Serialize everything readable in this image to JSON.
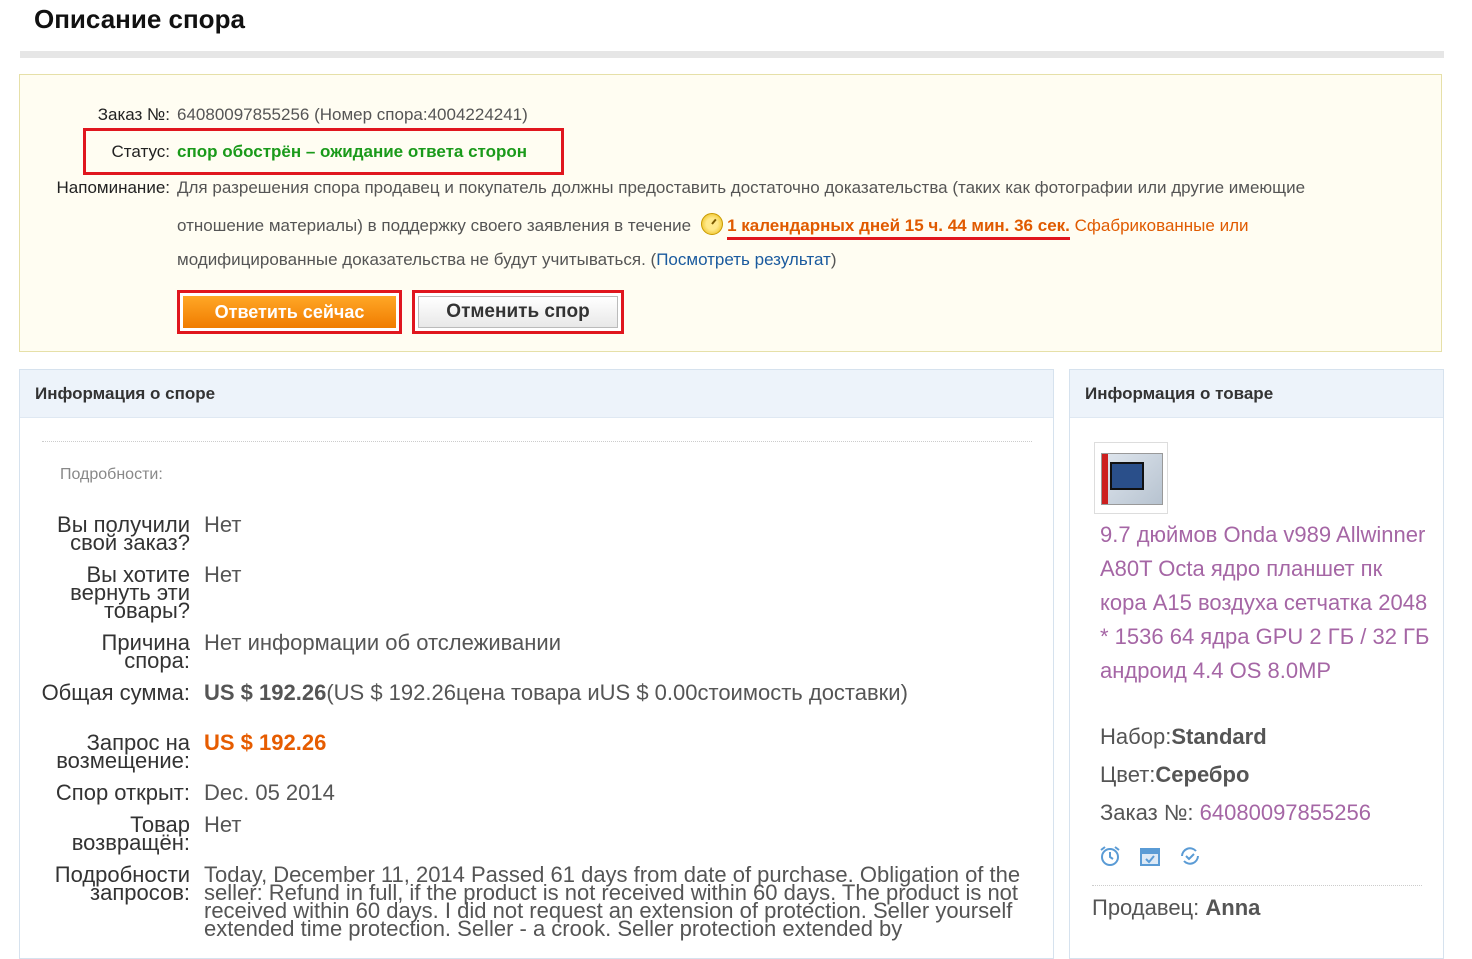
{
  "page": {
    "title": "Описание спора"
  },
  "summary": {
    "order_label": "Заказ №:",
    "order_value": "64080097855256 (Номер спора:4004224241)",
    "status_label": "Статус:",
    "status_value": "спор обострён – ожидание ответа сторон",
    "reminder_label": "Напоминание:",
    "reminder_line1": "Для разрешения спора продавец и покупатель должны предоставить достаточно доказательства (таких как фотографии или другие имеющие",
    "reminder_line2_text": "отношение материалы) в поддержку своего заявления в течение",
    "countdown": "1 календарных дней 15 ч. 44 мин. 36 сек.",
    "reminder_line2_tail": " Сфабрикованные или",
    "reminder_line3_text": "модифицированные доказательства не будут учитываться. (",
    "view_result_link": "Посмотреть результат",
    "reminder_line3_close": ")",
    "reply_button": "Ответить сейчас",
    "cancel_button": "Отменить спор"
  },
  "dispute_info": {
    "header": "Информация о споре",
    "details_caption": "Подробности:",
    "rows": [
      {
        "label": "Вы получили свой заказ?",
        "value": "Нет"
      },
      {
        "label": "Вы хотите вернуть эти товары?",
        "value": "Нет"
      },
      {
        "label": "Причина спора:",
        "value": "Нет информации об отслеживании"
      },
      {
        "label": "Общая сумма:",
        "value_bold": "US $ 192.26",
        "value_rest": "(US $ 192.26цена товара иUS $ 0.00стоимость доставки)"
      },
      {
        "label": "Запрос на возмещение:",
        "value": "US $ 192.26"
      },
      {
        "label": "Спор открыт:",
        "value": "Dec. 05 2014"
      },
      {
        "label": "Товар возвращён:",
        "value": "Нет"
      },
      {
        "label": "Подробности запросов:",
        "value": "Today, December 11, 2014 Passed 61 days from date of purchase. Obligation of the seller: Refund in full, if the product is not received within 60 days. The product is not received within 60 days. I did not request an extension of protection. Seller yourself extended time protection. Seller - a crook. Seller protection extended by"
      }
    ]
  },
  "product_info": {
    "header": "Информация о товаре",
    "title": "9.7 дюймов Onda v989 Allwinner A80T Octa ядро планшет пк кора A15 воздуха сетчатка 2048 * 1536 64 ядра GPU 2 ГБ / 32 ГБ андроид 4.4 OS 8.0MP",
    "set_label": "Набор:",
    "set_value": "Standard",
    "color_label": "Цвет:",
    "color_value": "Серебро",
    "order_label": "Заказ №: ",
    "order_value": "64080097855256",
    "icons": [
      "alarm-clock-icon",
      "calendar-icon",
      "refresh-check-icon"
    ],
    "seller_label": "Продавец: ",
    "seller_value": "Anna"
  },
  "colors": {
    "accent_orange": "#f07c00",
    "highlight_red": "#e0161e",
    "status_green": "#1a9a1a",
    "link_purple": "#a566a5"
  }
}
